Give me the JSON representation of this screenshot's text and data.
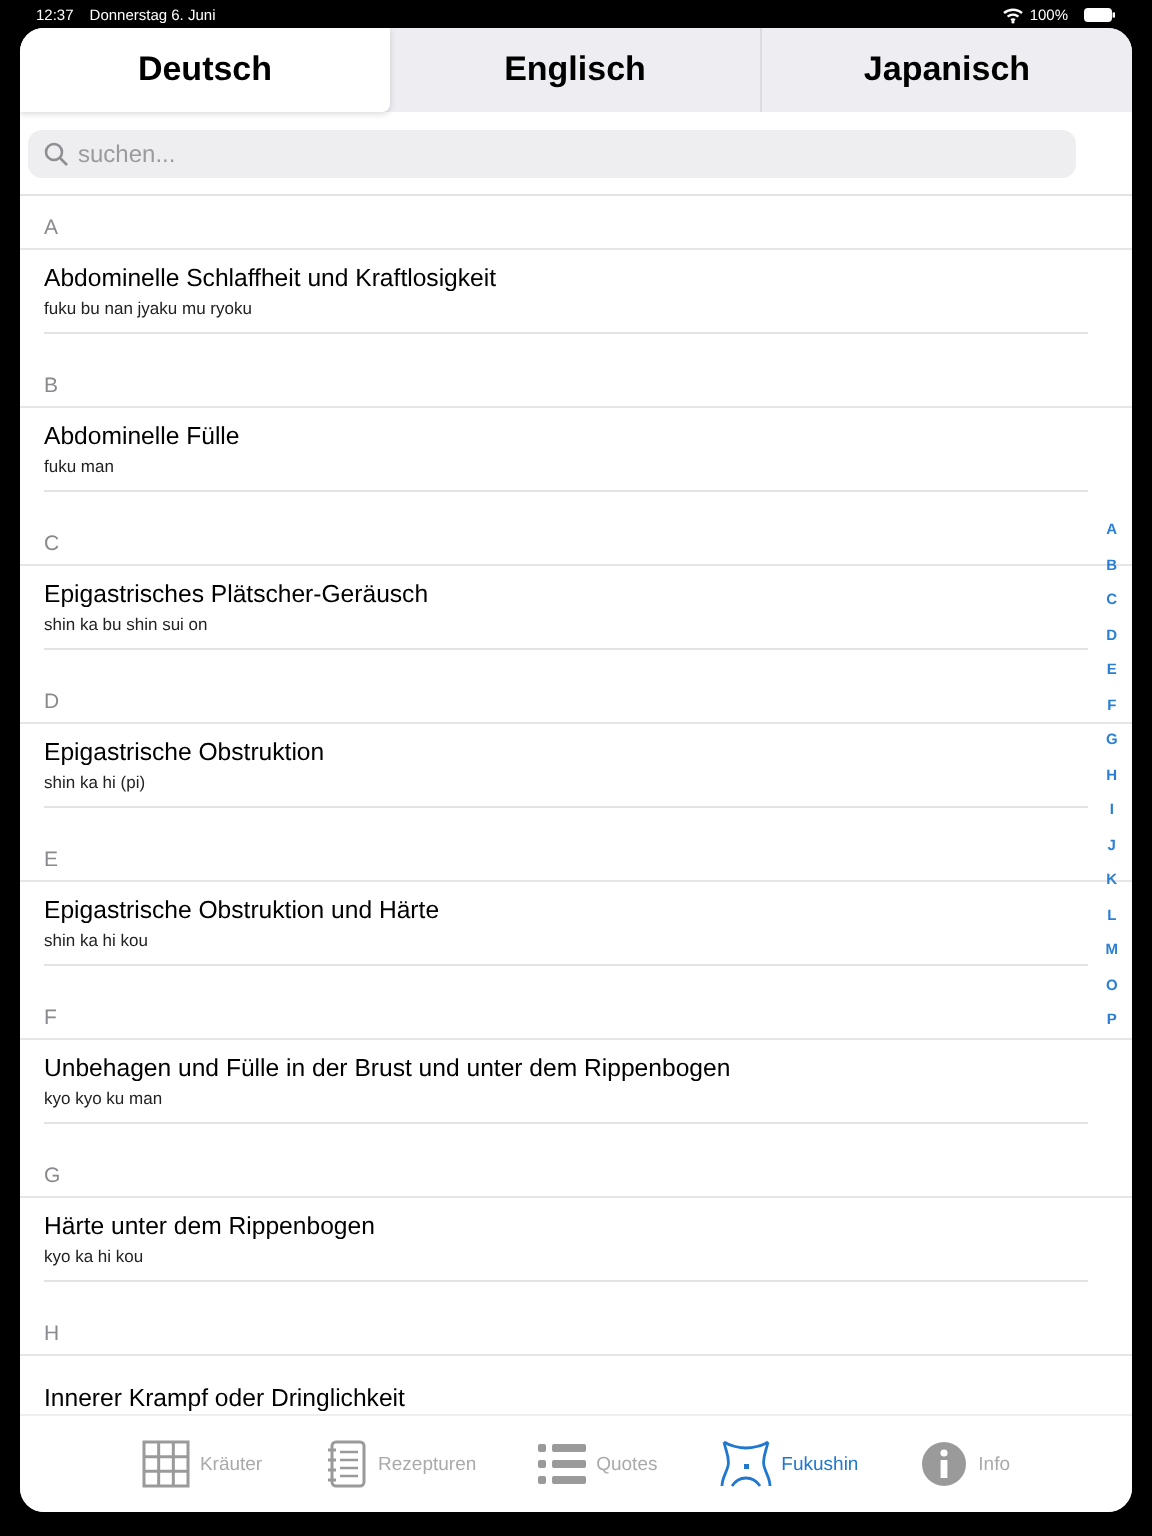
{
  "status_bar": {
    "time": "12:37",
    "date": "Donnerstag 6. Juni",
    "battery": "100%"
  },
  "tabs": [
    {
      "label": "Deutsch",
      "selected": true
    },
    {
      "label": "Englisch",
      "selected": false
    },
    {
      "label": "Japanisch",
      "selected": false
    }
  ],
  "search": {
    "placeholder": "suchen..."
  },
  "sections": [
    {
      "letter": "A",
      "items": [
        {
          "title": "Abdominelle Schlaffheit und Kraftlosigkeit",
          "subtitle": "fuku bu nan jyaku mu ryoku"
        }
      ]
    },
    {
      "letter": "B",
      "items": [
        {
          "title": "Abdominelle Fülle",
          "subtitle": "fuku man"
        }
      ]
    },
    {
      "letter": "C",
      "items": [
        {
          "title": "Epigastrisches Plätscher-Geräusch",
          "subtitle": "shin ka bu shin sui on"
        }
      ]
    },
    {
      "letter": "D",
      "items": [
        {
          "title": "Epigastrische Obstruktion",
          "subtitle": "shin ka hi (pi)"
        }
      ]
    },
    {
      "letter": "E",
      "items": [
        {
          "title": "Epigastrische Obstruktion und Härte",
          "subtitle": "shin ka hi kou"
        }
      ]
    },
    {
      "letter": "F",
      "items": [
        {
          "title": "Unbehagen und Fülle in der Brust und unter dem Rippenbogen",
          "subtitle": "kyo kyo ku man"
        }
      ]
    },
    {
      "letter": "G",
      "items": [
        {
          "title": "Härte unter dem Rippenbogen",
          "subtitle": "kyo ka hi kou"
        }
      ]
    },
    {
      "letter": "H",
      "items": [
        {
          "title": "Innerer Krampf oder Dringlichkeit"
        }
      ]
    }
  ],
  "index_letters": [
    "A",
    "B",
    "C",
    "D",
    "E",
    "F",
    "G",
    "H",
    "I",
    "J",
    "K",
    "L",
    "M",
    "O",
    "P"
  ],
  "tab_bar": [
    {
      "kind": "grid",
      "label": "Kräuter",
      "selected": false
    },
    {
      "kind": "notebook",
      "label": "Rezepturen",
      "selected": false
    },
    {
      "kind": "list",
      "label": "Quotes",
      "selected": false
    },
    {
      "kind": "torso",
      "label": "Fukushin",
      "selected": true
    },
    {
      "kind": "info",
      "label": "Info",
      "selected": false
    }
  ]
}
